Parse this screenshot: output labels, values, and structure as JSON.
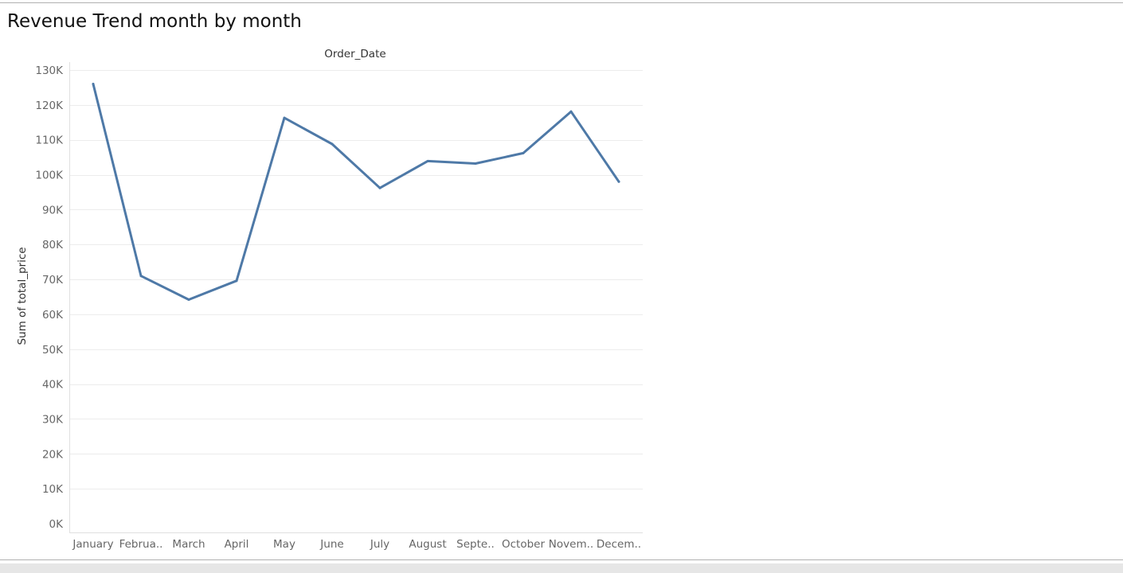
{
  "title": "Revenue Trend month by month",
  "chart_data": {
    "type": "line",
    "title": "Revenue Trend month by month",
    "column_header": "Order_Date",
    "xlabel": "",
    "ylabel": "Sum of total_price",
    "categories": [
      "January",
      "February",
      "March",
      "April",
      "May",
      "June",
      "July",
      "August",
      "September",
      "October",
      "November",
      "December"
    ],
    "tick_labels": [
      "January",
      "Februa..",
      "March",
      "April",
      "May",
      "June",
      "July",
      "August",
      "Septe..",
      "October",
      "Novem..",
      "Decem.."
    ],
    "series": [
      {
        "values": [
          126000,
          71000,
          64200,
          69600,
          116300,
          108800,
          96200,
          103900,
          103200,
          106200,
          118100,
          98000
        ]
      }
    ],
    "ylim": [
      0,
      130000
    ],
    "yticks": [
      0,
      10000,
      20000,
      30000,
      40000,
      50000,
      60000,
      70000,
      80000,
      90000,
      100000,
      110000,
      120000,
      130000
    ],
    "ytick_labels": [
      "0K",
      "10K",
      "20K",
      "30K",
      "40K",
      "50K",
      "60K",
      "70K",
      "80K",
      "90K",
      "100K",
      "110K",
      "120K",
      "130K"
    ],
    "grid": true,
    "line_color": "#4e79a7"
  }
}
